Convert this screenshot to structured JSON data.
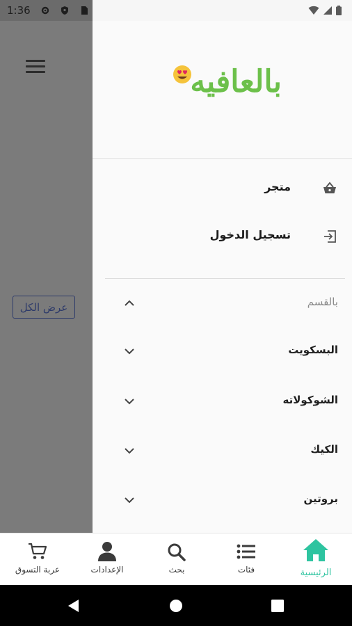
{
  "status_bar": {
    "time": "1:36"
  },
  "underlying": {
    "view_all_label": "عرض الكل"
  },
  "drawer": {
    "logo_text": "بالعافيه",
    "menu": [
      {
        "label": "متجر",
        "icon": "basket-icon"
      },
      {
        "label": "تسجيل الدخول",
        "icon": "login-icon"
      }
    ],
    "section_label": "بالقسم",
    "categories": [
      {
        "label": "البسكويت"
      },
      {
        "label": "الشوكولاته"
      },
      {
        "label": "الكيك"
      },
      {
        "label": "بروتين"
      }
    ]
  },
  "bottom_nav": {
    "accent": "#2ec4a0",
    "items": [
      {
        "label": "الرئيسية",
        "icon": "home-icon",
        "active": true
      },
      {
        "label": "فئات",
        "icon": "list-icon"
      },
      {
        "label": "بحث",
        "icon": "search-icon"
      },
      {
        "label": "الإعدادات",
        "icon": "person-icon"
      },
      {
        "label": "عربة التسوق",
        "icon": "cart-icon"
      }
    ]
  }
}
